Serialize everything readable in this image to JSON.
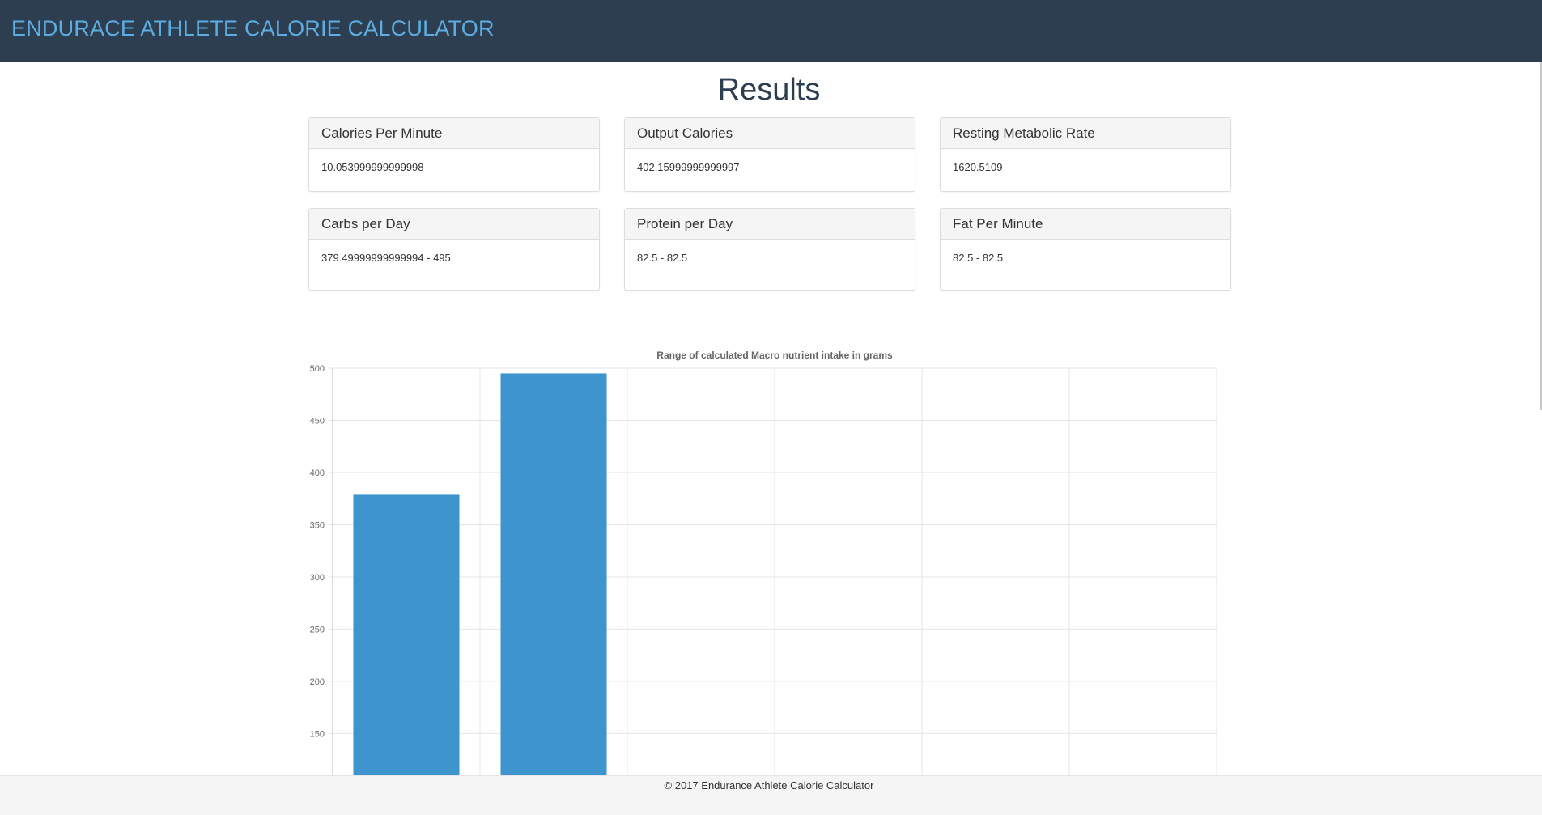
{
  "navbar": {
    "brand": "ENDURACE ATHLETE CALORIE CALCULATOR",
    "bg_color": "#2c3e50",
    "brand_color": "#5dade2"
  },
  "main": {
    "title": "Results",
    "panels": [
      {
        "heading": "Calories Per Minute",
        "value": "10.053999999999998"
      },
      {
        "heading": "Output Calories",
        "value": "402.15999999999997"
      },
      {
        "heading": "Resting Metabolic Rate",
        "value": "1620.5109"
      },
      {
        "heading": "Carbs per Day",
        "value": "379.49999999999994 - 495"
      },
      {
        "heading": "Protein per Day",
        "value": "82.5 - 82.5"
      },
      {
        "heading": "Fat Per Minute",
        "value": "82.5 - 82.5"
      }
    ]
  },
  "chart_data": {
    "type": "bar",
    "title": "Range of calculated Macro nutrient intake in grams",
    "xlabel": "",
    "ylabel": "",
    "categories": [
      "",
      "",
      "",
      "",
      "",
      ""
    ],
    "values": [
      379.49999999999994,
      495,
      null,
      null,
      null,
      null
    ],
    "ylim": [
      110,
      500
    ],
    "yticks": [
      500,
      450,
      400,
      350,
      300,
      250,
      200,
      150
    ],
    "grid": true,
    "bar_color": "#3e95cd"
  },
  "footer": {
    "text": "© 2017 Endurance Athlete Calorie Calculator"
  }
}
